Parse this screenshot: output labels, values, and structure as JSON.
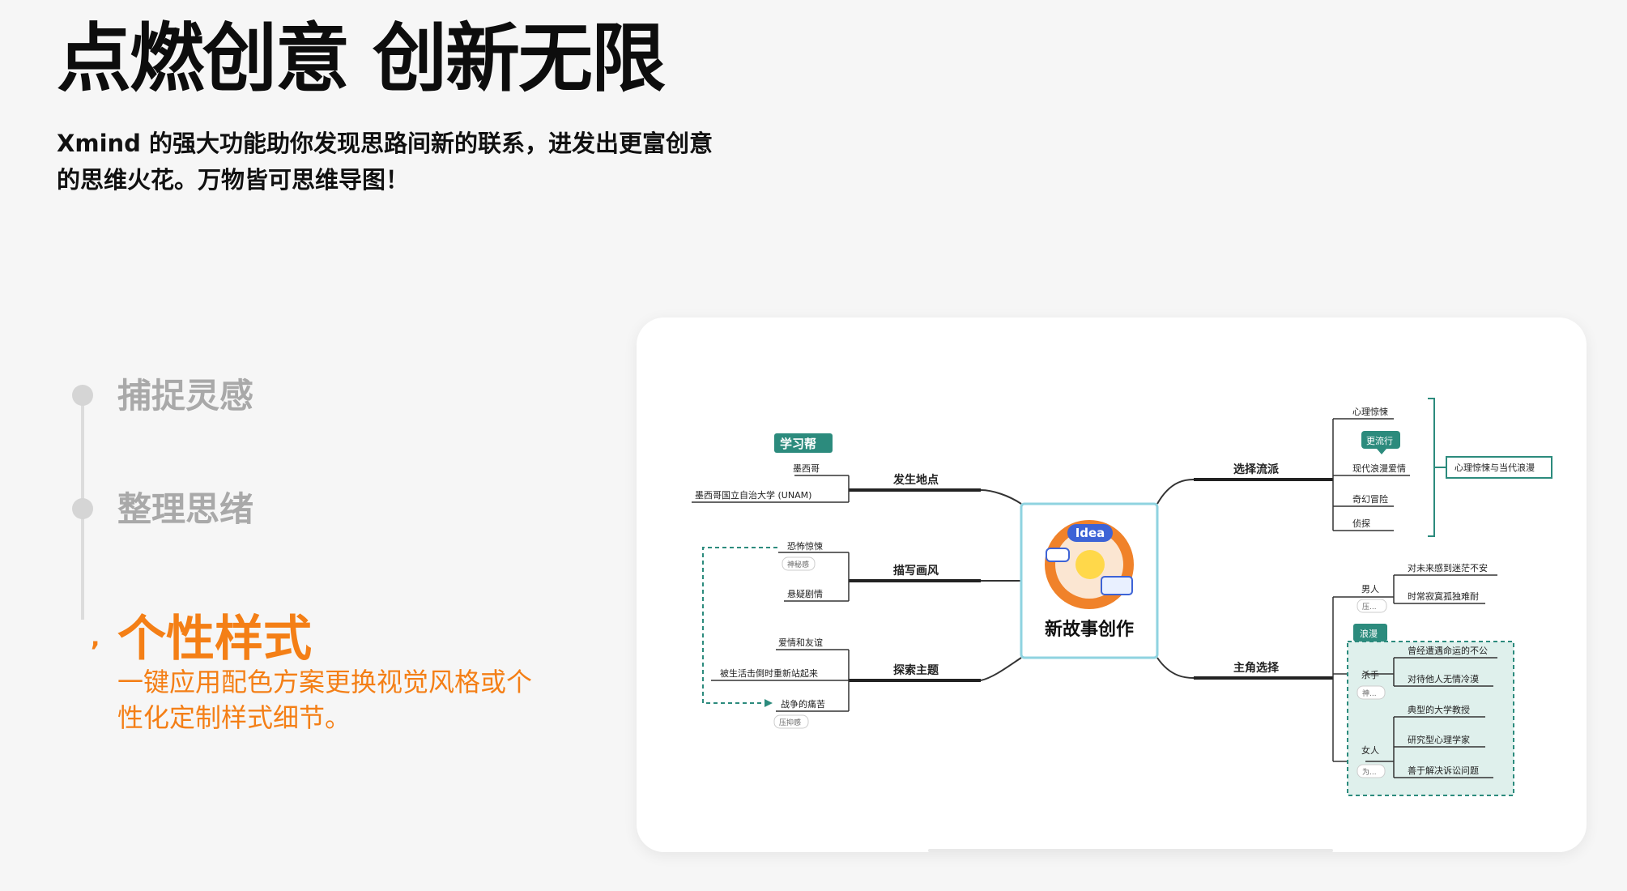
{
  "hero": {
    "title": "点燃创意 创新无限",
    "subtitle_line1": "Xmind 的强大功能助你发现思路间新的联系，进发出更富创意",
    "subtitle_line2": "的思维火花。万物皆可思维导图！"
  },
  "features": {
    "items": [
      {
        "label": "捕捉灵感",
        "active": false
      },
      {
        "label": "整理思绪",
        "active": false
      },
      {
        "label": "个性样式",
        "active": true,
        "description": "一键应用配色方案更换视觉风格或个性化定制样式细节。"
      }
    ]
  },
  "mindmap": {
    "central": {
      "label": "新故事创作",
      "badge": "Idea"
    },
    "left": [
      {
        "label": "发生地点",
        "tag": "学习帮",
        "children": [
          "墨西哥",
          "墨西哥国立自治大学 (UNAM)"
        ]
      },
      {
        "label": "描写画风",
        "children": [
          "恐怖惊悚",
          "悬疑剧情"
        ],
        "notes": [
          "神秘感"
        ]
      },
      {
        "label": "探索主题",
        "children": [
          "爱情和友谊",
          "被生活击倒时重新站起来",
          "战争的痛苦"
        ],
        "notes": [
          "压抑感"
        ]
      }
    ],
    "right": [
      {
        "label": "选择流派",
        "children": [
          "心理惊悚",
          "现代浪漫爱情",
          "奇幻冒险",
          "侦探"
        ],
        "callout": "更流行",
        "summary": "心理惊悚与当代浪漫"
      },
      {
        "label": "主角选择",
        "boundary_label": "浪漫",
        "groups": [
          {
            "label": "男人",
            "note": "压...",
            "children": [
              "对未来感到迷茫不安",
              "时常寂寞孤独难耐"
            ]
          },
          {
            "label": "杀手",
            "note": "神...",
            "children": [
              "曾经遭遇命运的不公",
              "对待他人无情冷漠"
            ]
          },
          {
            "label": "女人",
            "note": "为...",
            "children": [
              "典型的大学教授",
              "研究型心理学家",
              "善于解决诉讼问题"
            ]
          }
        ]
      }
    ]
  },
  "colors": {
    "accent": "#f47f16",
    "teal": "#2c8b7d",
    "inactive": "#a9a9a9",
    "central_border": "#8fd3e0"
  }
}
